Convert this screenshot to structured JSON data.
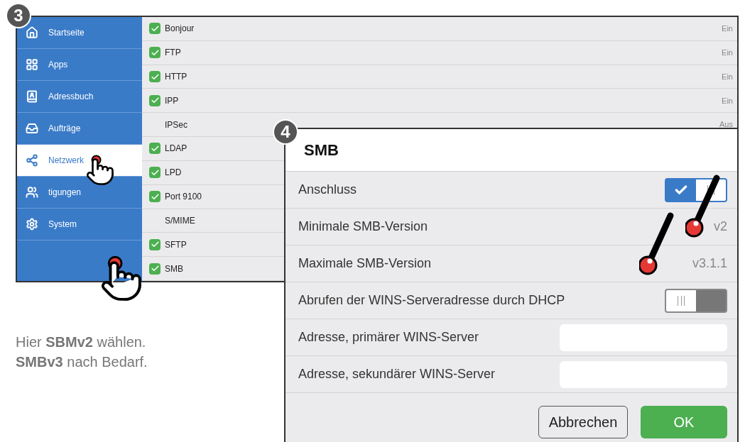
{
  "steps": [
    {
      "label": "3"
    },
    {
      "label": "4"
    }
  ],
  "sidebar": {
    "items": [
      {
        "label": "Startseite",
        "selected": false
      },
      {
        "label": "Apps",
        "selected": false
      },
      {
        "label": "Adressbuch",
        "selected": false
      },
      {
        "label": "Aufträge",
        "selected": false
      },
      {
        "label": "Netzwerk",
        "selected": true
      },
      {
        "label": "tigungen",
        "selected": false
      },
      {
        "label": "System",
        "selected": false
      }
    ]
  },
  "protocols": [
    {
      "name": "Bonjour",
      "checked": true,
      "status": "Ein"
    },
    {
      "name": "FTP",
      "checked": true,
      "status": "Ein"
    },
    {
      "name": "HTTP",
      "checked": true,
      "status": "Ein"
    },
    {
      "name": "IPP",
      "checked": true,
      "status": "Ein"
    },
    {
      "name": "IPSec",
      "checked": false,
      "status": "Aus"
    },
    {
      "name": "LDAP",
      "checked": true
    },
    {
      "name": "LPD",
      "checked": true
    },
    {
      "name": "Port 9100",
      "checked": true
    },
    {
      "name": "S/MIME",
      "checked": false
    },
    {
      "name": "SFTP",
      "checked": true
    },
    {
      "name": "SMB",
      "checked": true
    }
  ],
  "caption": [
    "Hier **SBMv2** wählen.",
    "**SMBv3** nach Bedarf."
  ],
  "dialog": {
    "title": "SMB",
    "rows": [
      {
        "kind": "toggle",
        "label": "Anschluss",
        "on": true
      },
      {
        "kind": "value",
        "label": "Minimale SMB-Version",
        "value": "v2"
      },
      {
        "kind": "value",
        "label": "Maximale SMB-Version",
        "value": "v3.1.1"
      },
      {
        "kind": "toggle",
        "label": "Abrufen der WINS-Serveradresse durch DHCP",
        "on": false
      },
      {
        "kind": "input",
        "label": "Adresse, primärer WINS-Server"
      },
      {
        "kind": "input",
        "label": "Adresse, sekundärer WINS-Server"
      }
    ],
    "buttons": [
      {
        "label": "Abbrechen",
        "kind": "secondary"
      },
      {
        "label": "OK",
        "kind": "primary"
      }
    ]
  }
}
